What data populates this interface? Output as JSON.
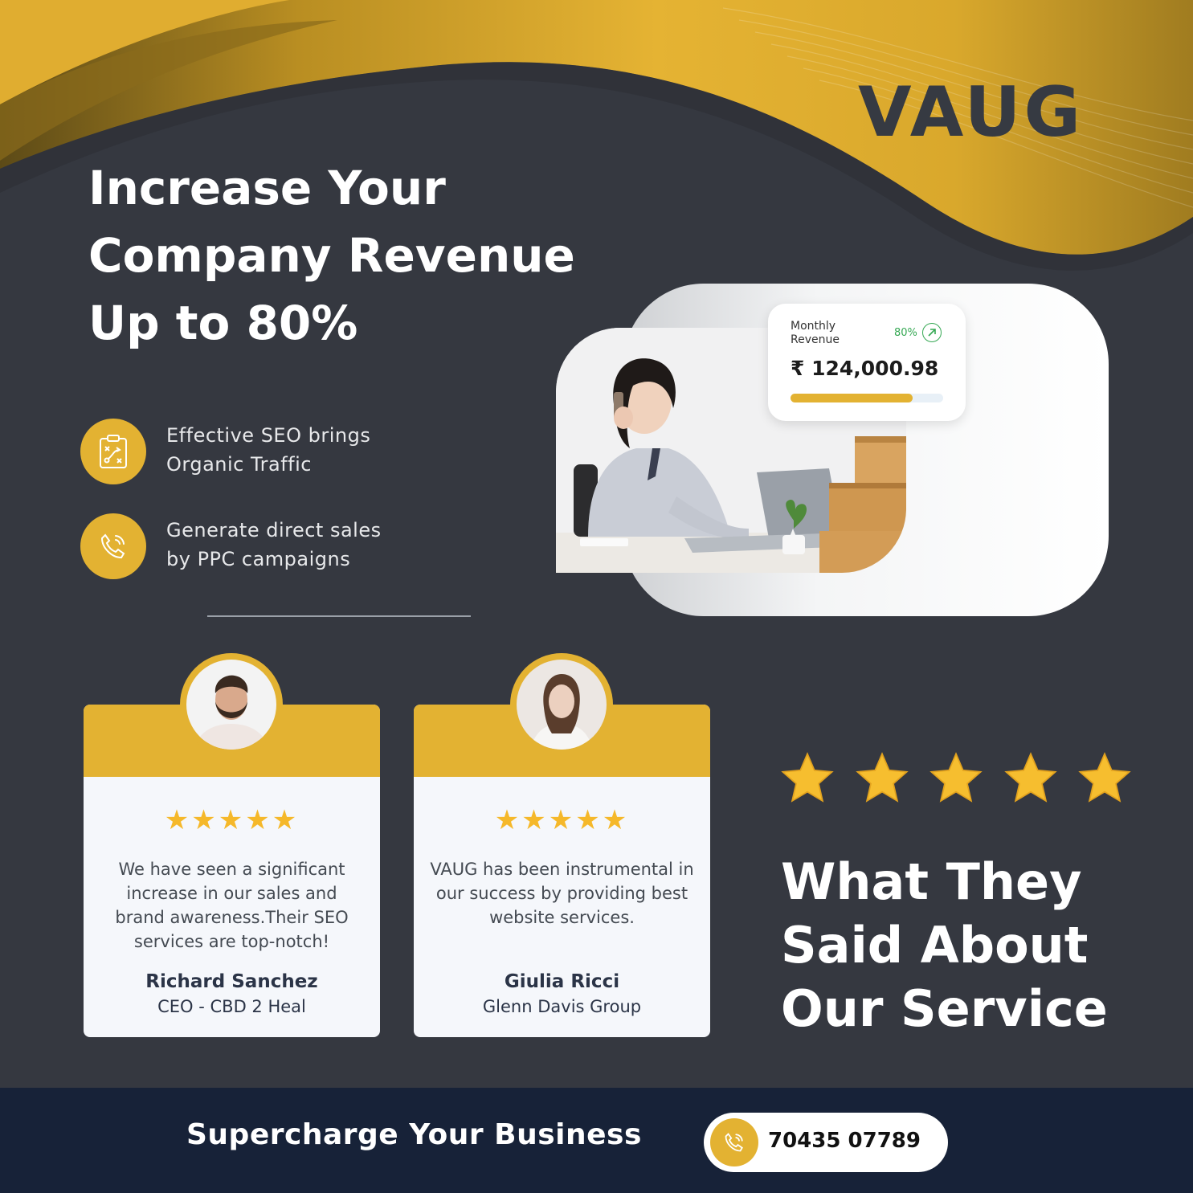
{
  "brand": {
    "name": "VAUG"
  },
  "headline": {
    "line1": "Increase Your",
    "line2": "Company Revenue",
    "line3": "Up to 80%"
  },
  "features": [
    {
      "icon": "clipboard-strategy-icon",
      "line1": "Effective SEO brings",
      "line2": "Organic Traffic"
    },
    {
      "icon": "phone-call-icon",
      "line1": "Generate direct sales",
      "line2": "by PPC campaigns"
    }
  ],
  "revenue_card": {
    "label_line1": "Monthly",
    "label_line2": "Revenue",
    "growth": "80%",
    "amount": "₹ 124,000.98",
    "progress": 0.8
  },
  "testimonials": [
    {
      "stars": "★★★★★",
      "quote": "We have seen a significant increase in our sales and brand awareness.Their SEO services are top-notch!",
      "name": "Richard Sanchez",
      "role": "CEO - CBD 2 Heal"
    },
    {
      "stars": "★★★★★",
      "quote": "VAUG  has been instrumental in our success by providing best website services.",
      "name": "Giulia Ricci",
      "role": "Glenn Davis Group"
    }
  ],
  "reviews_heading": {
    "line1": "What They",
    "line2": "Said About",
    "line3": "Our Service",
    "rating": 5
  },
  "footer": {
    "tagline": "Supercharge Your Business",
    "phone": "70435 07789"
  },
  "colors": {
    "accent": "#e3b232",
    "background": "#353840",
    "footer": "#172238",
    "card": "#f5f7fb"
  }
}
